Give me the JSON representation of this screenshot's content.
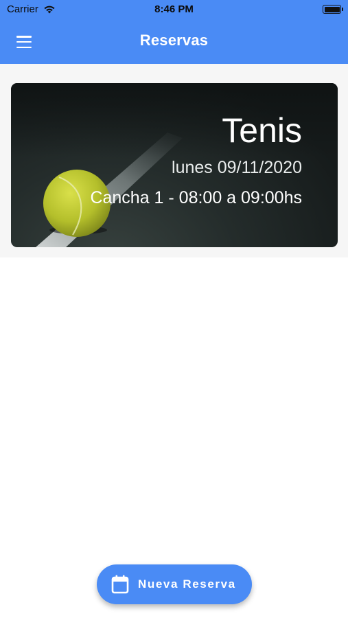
{
  "status_bar": {
    "carrier": "Carrier",
    "time": "8:46 PM",
    "icons": [
      "wifi-icon",
      "battery-icon"
    ]
  },
  "app_bar": {
    "title": "Reservas",
    "menu_icon": "hamburger-menu-icon"
  },
  "reservations": [
    {
      "sport": "Tenis",
      "date": "lunes 09/11/2020",
      "slot": "Cancha 1 - 08:00 a 09:00hs",
      "image": "tennis-ball-on-court"
    }
  ],
  "fab": {
    "label": "Nueva Reserva",
    "icon": "calendar-icon"
  },
  "colors": {
    "primary": "#4a8bf5",
    "background": "#ffffff",
    "list_background": "#f6f6f6"
  }
}
